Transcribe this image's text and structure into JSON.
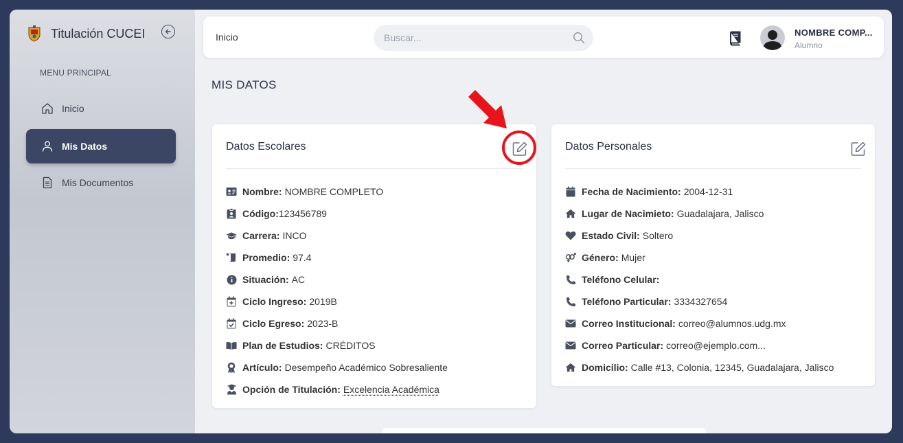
{
  "app": {
    "title": "Titulación CUCEI"
  },
  "sidebar": {
    "menu_title": "MENU PRINCIPAL",
    "items": [
      {
        "label": "Inicio",
        "icon": "home-icon",
        "active": false
      },
      {
        "label": "Mis Datos",
        "icon": "user-icon",
        "active": true
      },
      {
        "label": "Mis Documentos",
        "icon": "document-icon",
        "active": false
      }
    ]
  },
  "header": {
    "breadcrumb": "Inicio",
    "search": {
      "placeholder": "Buscar...",
      "value": ""
    },
    "user": {
      "name": "NOMBRE COMP...",
      "role": "Alumno"
    }
  },
  "page": {
    "title": "MIS DATOS"
  },
  "datos_escolares": {
    "title": "Datos Escolares",
    "rows": [
      {
        "icon": "id-card-icon",
        "label": "Nombre:",
        "value": "NOMBRE COMPLETO"
      },
      {
        "icon": "id-badge-icon",
        "label": "Código:",
        "value": "123456789"
      },
      {
        "icon": "graduation-cap-icon",
        "label": "Carrera:",
        "value": "INCO"
      },
      {
        "icon": "scroll-icon",
        "label": "Promedio:",
        "value": "97.4"
      },
      {
        "icon": "info-circle-icon",
        "label": "Situación:",
        "value": "AC"
      },
      {
        "icon": "calendar-plus-icon",
        "label": "Ciclo Ingreso:",
        "value": "2019B"
      },
      {
        "icon": "calendar-check-icon",
        "label": "Ciclo Egreso:",
        "value": "2023-B"
      },
      {
        "icon": "book-open-icon",
        "label": "Plan de Estudios:",
        "value": "CRÉDITOS"
      },
      {
        "icon": "award-icon",
        "label": "Artículo:",
        "value": "Desempeño Académico Sobresaliente"
      },
      {
        "icon": "graduate-user-icon",
        "label": "Opción de Titulación:",
        "value": "Excelencia Académica"
      }
    ]
  },
  "datos_personales": {
    "title": "Datos Personales",
    "rows": [
      {
        "icon": "calendar-icon",
        "label": "Fecha de Nacimiento:",
        "value": "2004-12-31"
      },
      {
        "icon": "house-icon",
        "label": "Lugar de Nacimieto:",
        "value": "Guadalajara, Jalisco"
      },
      {
        "icon": "heart-icon",
        "label": "Estado Civil:",
        "value": "Soltero"
      },
      {
        "icon": "venus-mars-icon",
        "label": "Género:",
        "value": "Mujer"
      },
      {
        "icon": "phone-icon",
        "label": "Teléfono Celular:",
        "value": ""
      },
      {
        "icon": "phone-icon",
        "label": "Teléfono Particular:",
        "value": "3334327654"
      },
      {
        "icon": "envelope-icon",
        "label": "Correo Institucional:",
        "value": "correo@alumnos.udg.mx"
      },
      {
        "icon": "envelope-icon",
        "label": "Correo Particular:",
        "value": "correo@ejemplo.com..."
      },
      {
        "icon": "house-icon",
        "label": "Domicilio:",
        "value": "Calle #13, Colonia, 12345, Guadalajara, Jalisco"
      }
    ]
  },
  "colors": {
    "sidebar_active": "#3a4663",
    "annotation": "#e8141c",
    "frame": "#2d3a5c"
  }
}
